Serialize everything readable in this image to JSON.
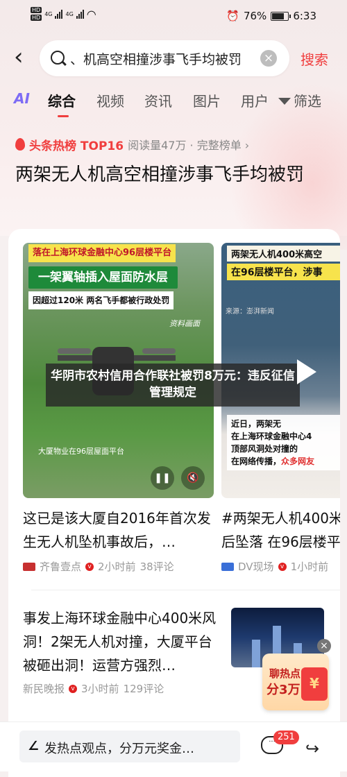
{
  "status": {
    "hd1": "HD",
    "hd2": "HD",
    "net": "4G",
    "battery": "76%",
    "time": "6:33"
  },
  "search": {
    "query": "、机高空相撞涉事飞手均被罚",
    "button": "搜索"
  },
  "tabs": [
    "AI",
    "综合",
    "视频",
    "资讯",
    "图片",
    "用户",
    "筛选"
  ],
  "hot": {
    "label": "头条热榜 TOP16",
    "meta": "阅读量47万 · 完整榜单 ›"
  },
  "headline": "两架无人机高空相撞涉事飞手均被罚",
  "videos": [
    {
      "banner1": "落在上海环球金融中心96层楼平台",
      "banner2": "一架翼轴插入屋面防水层",
      "banner3": "因超过120米 两名飞手都被行政处罚",
      "caption": "资料画面",
      "caption2": "大厦物业在96层屋面平台"
    },
    {
      "banner1": "两架无人机400米高空",
      "banner2": "在96层楼平台，涉事",
      "source": "来源：澎湃新闻",
      "box1": "近日，两架无",
      "box2": "在上海环球金融中心4",
      "box3": "顶部风洞处对撞的",
      "box4a": "在网络传播，",
      "box4b": "众多网友"
    }
  ],
  "overlay": "华阴市农村信用合作联社被罚8万元：违反征信管理规定",
  "items": [
    {
      "title": "这已是该大厦自2016年首次发生无人机坠机事故后，…",
      "source": "齐鲁壹点",
      "time": "2小时前",
      "comments": "38评论"
    },
    {
      "title": "#两架无人机400米后坠落 在96层楼平",
      "source": "DV现场",
      "time": "1小时前"
    },
    {
      "title": "事发上海环球金融中心400米风洞！2架无人机对撞，大厦平台被砸出洞！运营方强烈…",
      "source": "新民晚报",
      "time": "3小时前",
      "comments": "129评论"
    }
  ],
  "promo": {
    "line1": "聊热点",
    "line2": "分3万",
    "env": "¥"
  },
  "bottom": {
    "placeholder": "发热点观点，分万元奖金…",
    "badge": "251"
  },
  "colors": {
    "accent": "#f03e3e",
    "ai": "#7d6bf5"
  }
}
